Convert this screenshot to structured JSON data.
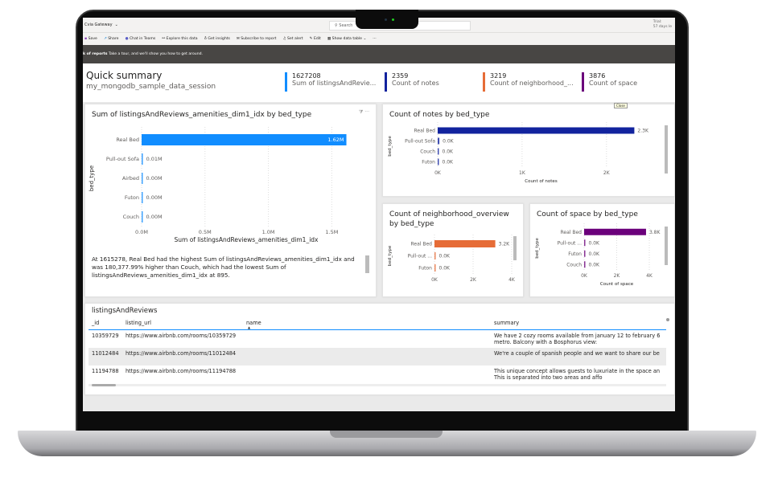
{
  "header": {
    "workspace": "Cvia Gateway",
    "search_placeholder": "Search",
    "trial": "Trial:",
    "trial_days": "57 days le"
  },
  "toolbar": {
    "items": [
      "Save",
      "Share",
      "Chat in Teams",
      "Explore this data",
      "Get insights",
      "Subscribe to report",
      "Set alert",
      "Edit",
      "Show data table",
      "···"
    ]
  },
  "banner": {
    "bold": "k of reports",
    "text": "Take a tour, and we'll show you how to get around."
  },
  "summary": {
    "title": "Quick summary",
    "subtitle": "my_mongodb_sample_data_session",
    "kpis": [
      {
        "value": "1627208",
        "label": "Sum of listingsAndRevie...",
        "color": "#118dff"
      },
      {
        "value": "2359",
        "label": "Count of notes",
        "color": "#12239e"
      },
      {
        "value": "3219",
        "label": "Count of neighborhood_...",
        "color": "#e66c37"
      },
      {
        "value": "3876",
        "label": "Count of space",
        "color": "#6b007b"
      }
    ]
  },
  "tooltip": "Close",
  "chart_data": [
    {
      "type": "bar",
      "title": "Sum of listingsAndReviews_amenities_dim1_idx by bed_type",
      "categories": [
        "Real Bed",
        "Pull-out Sofa",
        "Airbed",
        "Futon",
        "Couch"
      ],
      "values": [
        1615278,
        10000,
        1000,
        1000,
        895
      ],
      "data_labels": [
        "1.62M",
        "0.01M",
        "0.00M",
        "0.00M",
        "0.00M"
      ],
      "xlabel": "Sum of listingsAndReviews_amenities_dim1_idx",
      "ylabel": "bed_type",
      "xticks": [
        "0.0M",
        "0.5M",
        "1.0M",
        "1.5M"
      ],
      "xtick_values": [
        0,
        500000,
        1000000,
        1500000
      ],
      "xlim": [
        0,
        1650000
      ],
      "color": "#118dff"
    },
    {
      "type": "bar",
      "title": "Count of notes by bed_type",
      "categories": [
        "Real Bed",
        "Pull-out Sofa",
        "Couch",
        "Futon"
      ],
      "values": [
        2330,
        20,
        10,
        10
      ],
      "data_labels": [
        "2.3K",
        "0.0K",
        "0.0K",
        "0.0K"
      ],
      "xlabel": "Count of notes",
      "ylabel": "bed_type",
      "xticks": [
        "0K",
        "1K",
        "2K"
      ],
      "xtick_values": [
        0,
        1000,
        2000
      ],
      "xlim": [
        0,
        2450
      ],
      "color": "#12239e"
    },
    {
      "type": "bar",
      "title": "Count of neighborhood_overview by bed_type",
      "categories": [
        "Real Bed",
        "Pull-out ...",
        "Futon"
      ],
      "values": [
        3150,
        20,
        10
      ],
      "data_labels": [
        "3.2K",
        "0.0K",
        "0.0K"
      ],
      "xlabel": "",
      "ylabel": "bed_type",
      "xticks": [
        "0K",
        "2K",
        "4K"
      ],
      "xtick_values": [
        0,
        2000,
        4000
      ],
      "xlim": [
        0,
        4000
      ],
      "color": "#e66c37"
    },
    {
      "type": "bar",
      "title": "Count of space by bed_type",
      "categories": [
        "Real Bed",
        "Pull-out ...",
        "Futon",
        "Couch"
      ],
      "values": [
        3800,
        20,
        10,
        10
      ],
      "data_labels": [
        "3.8K",
        "0.0K",
        "0.0K",
        "0.0K"
      ],
      "xlabel": "Count of space",
      "ylabel": "bed_type",
      "xticks": [
        "0K",
        "2K",
        "4K"
      ],
      "xtick_values": [
        0,
        2000,
        4000
      ],
      "xlim": [
        0,
        4000
      ],
      "color": "#6b007b"
    }
  ],
  "insight": "At 1615278, Real Bed had the highest Sum of listingsAndReviews_amenities_dim1_idx and was 180,377.99% higher than Couch, which had the lowest Sum of listingsAndReviews_amenities_dim1_idx at 895.",
  "table": {
    "title": "listingsAndReviews",
    "columns": [
      "_id",
      "listing_url",
      "name",
      "summary"
    ],
    "rows": [
      {
        "id": "10359729",
        "url": "https://www.airbnb.com/rooms/10359729",
        "name": "",
        "summary": "We have 2 cozy rooms available from january 12 to february 6",
        "summary2": "metro. Balcony with a Bosphorus view:"
      },
      {
        "id": "11012484",
        "url": "https://www.airbnb.com/rooms/11012484",
        "name": "",
        "summary": "We're a couple of spanish people and we want to share our be",
        "summary2": ""
      },
      {
        "id": "11194788",
        "url": "https://www.airbnb.com/rooms/11194788",
        "name": "",
        "summary": "This unique concept allows guests to luxuriate in the space an",
        "summary2": "This is separated into two areas and affo"
      }
    ]
  }
}
